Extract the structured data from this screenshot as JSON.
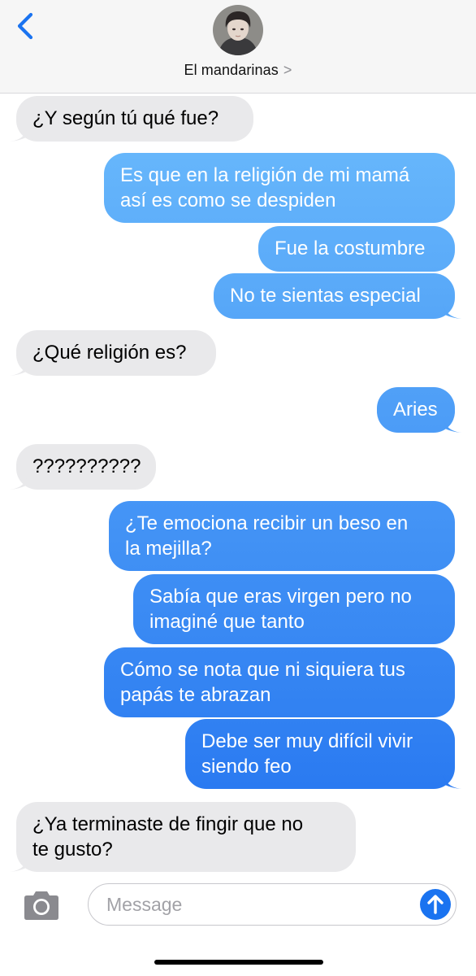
{
  "header": {
    "contact_name": "El mandarinas",
    "chevron": ">"
  },
  "messages": [
    {
      "from": "them",
      "lines": [
        "¿Y según tú qué fue?"
      ]
    },
    {
      "from": "me",
      "lines": [
        "Es que en la religión de mi mamá",
        "así es como se despiden"
      ]
    },
    {
      "from": "me",
      "lines": [
        "Fue la costumbre"
      ]
    },
    {
      "from": "me",
      "lines": [
        "No te sientas especial"
      ]
    },
    {
      "from": "them",
      "lines": [
        "¿Qué religión es?"
      ]
    },
    {
      "from": "me",
      "lines": [
        "Aries"
      ]
    },
    {
      "from": "them",
      "lines": [
        "??????????"
      ]
    },
    {
      "from": "me",
      "lines": [
        "¿Te emociona recibir un beso en",
        "la mejilla?"
      ]
    },
    {
      "from": "me",
      "lines": [
        "Sabía que eras virgen pero no",
        "imaginé que tanto"
      ]
    },
    {
      "from": "me",
      "lines": [
        "Cómo se nota que ni siquiera tus",
        "papás te abrazan"
      ]
    },
    {
      "from": "me",
      "lines": [
        "Debe ser muy difícil vivir",
        "siendo feo"
      ]
    },
    {
      "from": "them",
      "lines": [
        "¿Ya terminaste de fingir que no",
        "te gusto?"
      ]
    }
  ],
  "compose": {
    "placeholder": "Message"
  },
  "icons": {
    "back": "back-chevron-icon",
    "camera": "camera-icon",
    "send": "send-arrow-icon"
  },
  "colors": {
    "incoming": "#e9e9eb",
    "outgoing_top": "#5eb2fa",
    "outgoing_bottom": "#2a7cf2",
    "header_bg": "#f6f6f6",
    "accent": "#1a73f0"
  }
}
